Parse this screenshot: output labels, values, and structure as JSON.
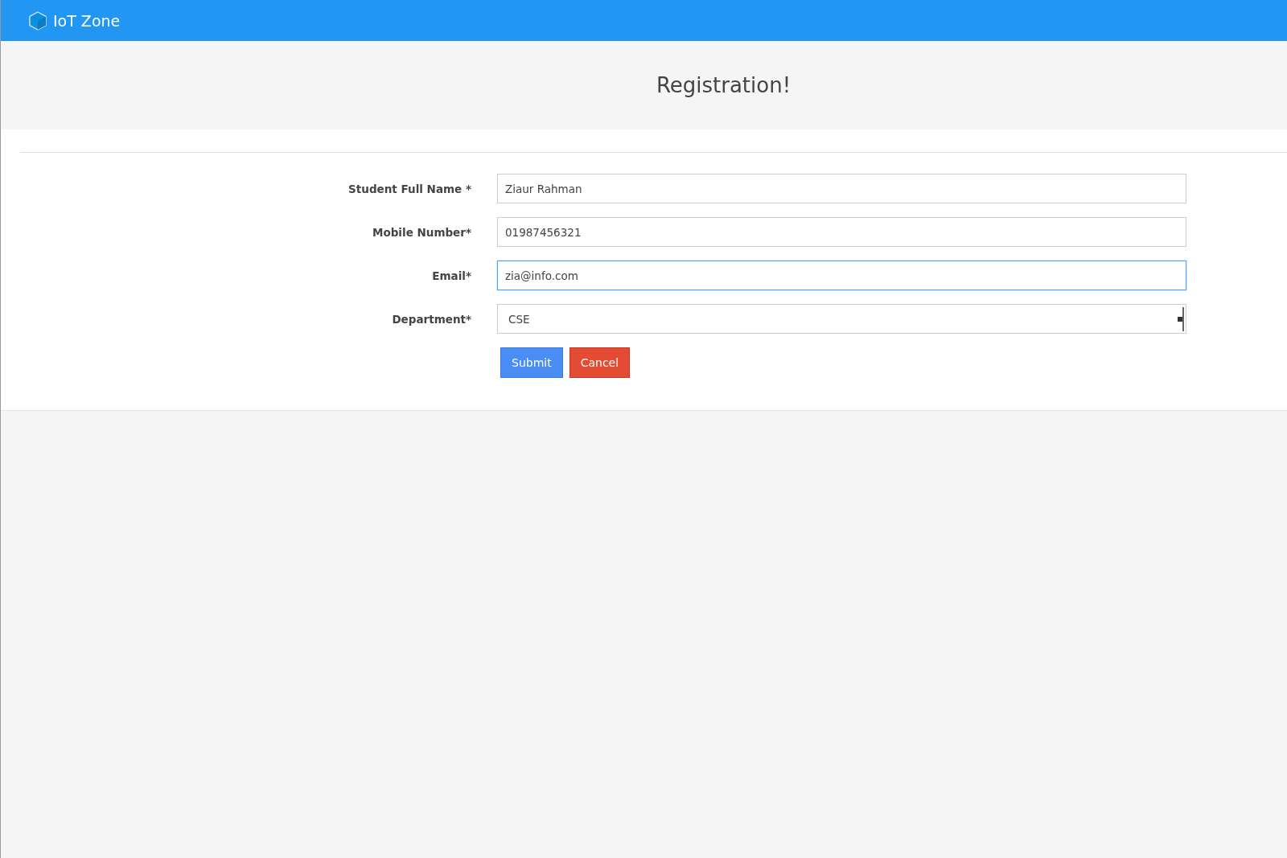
{
  "navbar": {
    "brand": "IoT Zone"
  },
  "page": {
    "title": "Registration!"
  },
  "form": {
    "fields": [
      {
        "kind": "input",
        "label": "Student Full Name *",
        "value": "Ziaur Rahman",
        "focused": false
      },
      {
        "kind": "input",
        "label": "Mobile Number*",
        "value": "01987456321",
        "focused": false
      },
      {
        "kind": "input",
        "label": "Email*",
        "value": "zia@info.com",
        "focused": true
      },
      {
        "kind": "select",
        "label": "Department*",
        "value": "CSE",
        "focused": false
      }
    ],
    "buttons": [
      {
        "kind": "primary",
        "label": "Submit"
      },
      {
        "kind": "danger",
        "label": "Cancel"
      }
    ]
  }
}
